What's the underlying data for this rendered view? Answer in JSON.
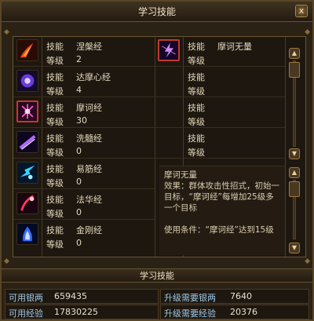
{
  "window": {
    "title": "学习技能",
    "close_label": "x"
  },
  "skills_left": [
    {
      "skill_label": "技能",
      "name": "涅槃经",
      "level_label": "等级",
      "level": "2",
      "icon": "fire-skill-icon"
    },
    {
      "skill_label": "技能",
      "name": "达摩心经",
      "level_label": "等级",
      "level": "4",
      "icon": "purple-orb-skill-icon"
    },
    {
      "skill_label": "技能",
      "name": "摩诃经",
      "level_label": "等级",
      "level": "30",
      "icon": "pink-burst-skill-icon"
    },
    {
      "skill_label": "技能",
      "name": "洗髓经",
      "level_label": "等级",
      "level": "0",
      "icon": "violet-slash-skill-icon"
    },
    {
      "skill_label": "技能",
      "name": "易筋经",
      "level_label": "等级",
      "level": "0",
      "icon": "cyan-spark-skill-icon"
    },
    {
      "skill_label": "技能",
      "name": "法华经",
      "level_label": "等级",
      "level": "0",
      "icon": "red-flare-skill-icon"
    },
    {
      "skill_label": "技能",
      "name": "金刚经",
      "level_label": "等级",
      "level": "0",
      "icon": "blue-flame-skill-icon"
    }
  ],
  "skills_right": [
    {
      "skill_label": "技能",
      "name": "摩诃无量",
      "level_label": "等级",
      "level": ""
    },
    {
      "skill_label": "技能",
      "name": "",
      "level_label": "等级",
      "level": ""
    },
    {
      "skill_label": "技能",
      "name": "",
      "level_label": "等级",
      "level": ""
    },
    {
      "skill_label": "技能",
      "name": "",
      "level_label": "等级",
      "level": ""
    }
  ],
  "description": {
    "title": "摩诃无量",
    "effect": "效果：群体攻击性招式，初始一目标，“摩诃经”每增加25级多一个目标",
    "condition": "使用条件：“摩诃经”达到15级"
  },
  "footer": {
    "button_label": "学习技能"
  },
  "stats": {
    "silver_label": "可用银两",
    "silver_value": "659435",
    "exp_label": "可用经验",
    "exp_value": "17830225",
    "need_silver_label": "升级需要银两",
    "need_silver_value": "7640",
    "need_exp_label": "升级需要经验",
    "need_exp_value": "20376"
  },
  "colors": {
    "accent_border": "#6b5430",
    "selected_border": "#c23a2a",
    "stat_label": "#9fc8e6"
  }
}
